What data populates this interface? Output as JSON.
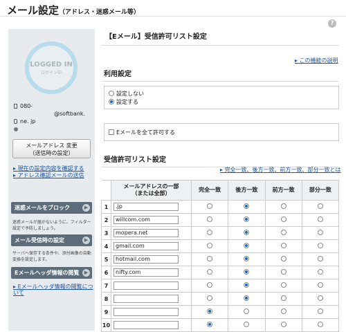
{
  "header": {
    "title": "メール設定",
    "subtitle": "（アドレス・迷惑メール等）"
  },
  "sidebar": {
    "badge_main": "LOGGED IN",
    "badge_sub": "ログイン中",
    "phone": "080-",
    "email_domain": "@softbank.",
    "email_tail": "ne. jp",
    "change_button_line1": "メールアドレス 変更",
    "change_button_line2": "（送信時の設定）",
    "link1": "現在の設定内容を確認する",
    "link2": "アドレス確認メールの送信",
    "sections": [
      {
        "label": "迷惑メールをブロック",
        "desc": "迷惑メールが届かないように、フィルター設定で予防しましょう。"
      },
      {
        "label": "メール受信時の設定",
        "desc": "サーバへ保存する条件や、添付画像の自動変換を設定します。"
      },
      {
        "label": "Eメールヘッダ情報の閲覧",
        "desc": ""
      }
    ],
    "link3": "Eメールヘッダ情報の閲覧について"
  },
  "main": {
    "title": "【Eメール】受信許可リスト設定",
    "help_link": "この機能の説明",
    "usage_title": "利用設定",
    "opt_off": "設定しない",
    "opt_on": "設定する",
    "allow_all": "Eメールを全て許可する",
    "list_title": "受信許可リスト設定",
    "match_links": "完全一致、後方一致、前方一致、部分一致とは",
    "columns": {
      "address": "メールアドレスの一部\n（または全部）",
      "exact": "完全一致",
      "suffix": "後方一致",
      "prefix": "前方一致",
      "partial": "部分一致"
    },
    "rows": [
      {
        "n": "1",
        "addr": ".jp",
        "sel": 1
      },
      {
        "n": "2",
        "addr": "willcom.com",
        "sel": 1
      },
      {
        "n": "3",
        "addr": "mopera.net",
        "sel": 1
      },
      {
        "n": "4",
        "addr": "gmail.com",
        "sel": 1
      },
      {
        "n": "5",
        "addr": "hotmail.com",
        "sel": 1
      },
      {
        "n": "6",
        "addr": "nifty.com",
        "sel": 1
      },
      {
        "n": "7",
        "addr": "",
        "sel": 1
      },
      {
        "n": "8",
        "addr": "",
        "sel": 1
      },
      {
        "n": "9",
        "addr": "",
        "sel": 0
      },
      {
        "n": "10",
        "addr": "",
        "sel": 0
      }
    ]
  }
}
